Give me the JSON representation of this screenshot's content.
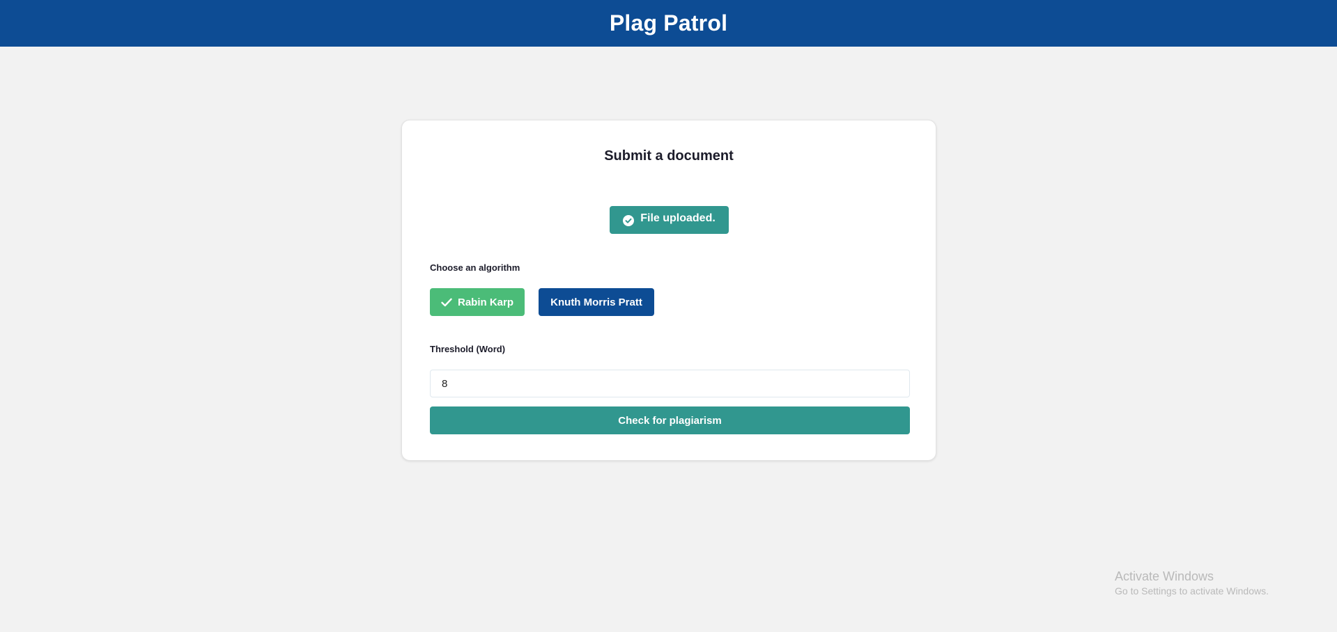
{
  "header": {
    "title": "Plag Patrol"
  },
  "card": {
    "title": "Submit a document",
    "upload_status": "File uploaded.",
    "algorithm_label": "Choose an algorithm",
    "algorithms": [
      {
        "label": "Rabin Karp",
        "selected": true
      },
      {
        "label": "Knuth Morris Pratt",
        "selected": false
      }
    ],
    "threshold_label": "Threshold (Word)",
    "threshold_value": "8",
    "submit_label": "Check for plagiarism"
  },
  "watermark": {
    "title": "Activate Windows",
    "subtitle": "Go to Settings to activate Windows."
  },
  "colors": {
    "header_bg": "#0d4c94",
    "teal": "#31978f",
    "selected_green": "#4bbc78",
    "page_bg": "#f2f2f2"
  },
  "icons": {
    "upload_status": "check-circle-icon",
    "selected_algorithm": "checkmark-icon"
  }
}
